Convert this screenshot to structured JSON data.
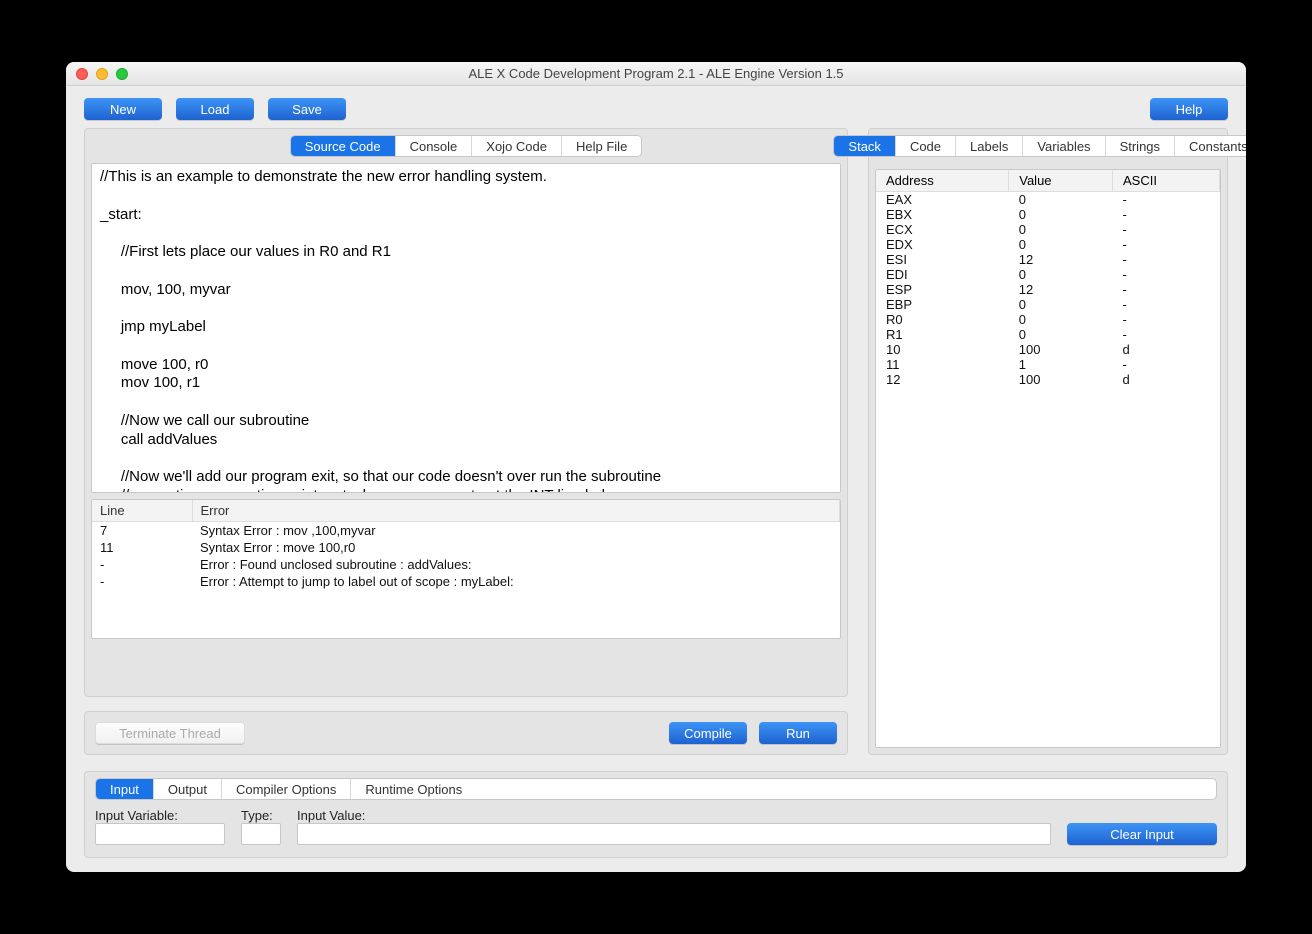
{
  "window_title": "ALE X Code Development Program 2.1 - ALE Engine Version 1.5",
  "toolbar": {
    "new": "New",
    "load": "Load",
    "save": "Save",
    "help": "Help"
  },
  "left_tabs": [
    "Source Code",
    "Console",
    "Xojo Code",
    "Help File"
  ],
  "left_tab_active": 0,
  "source_code": "//This is an example to demonstrate the new error handling system.\n\n_start:\n\n     //First lets place our values in R0 and R1\n\n     mov, 100, myvar\n\n     jmp myLabel\n\n     move 100, r0\n     mov 100, r1\n\n     //Now we call our subroutine\n     call addValues\n\n     //Now we'll add our program exit, so that our code doesn't over run the subroutine\n     //generating a execution pointer stack error, comment out the INT line below\n     //if you wish to see that.",
  "error_headers": [
    "Line",
    "Error"
  ],
  "errors": [
    {
      "line": "7",
      "msg": "Syntax Error : mov ,100,myvar"
    },
    {
      "line": "11",
      "msg": "Syntax Error : move 100,r0"
    },
    {
      "line": "-",
      "msg": "Error : Found unclosed subroutine : addValues:"
    },
    {
      "line": "-",
      "msg": "Error : Attempt to jump to label out of scope : myLabel:"
    }
  ],
  "actions": {
    "terminate": "Terminate Thread",
    "compile": "Compile",
    "run": "Run"
  },
  "right_tabs": [
    "Stack",
    "Code",
    "Labels",
    "Variables",
    "Strings",
    "Constants"
  ],
  "right_tab_active": 0,
  "stack_headers": [
    "Address",
    "Value",
    "ASCII"
  ],
  "stack": [
    {
      "a": "EAX",
      "v": "0",
      "c": "-"
    },
    {
      "a": "EBX",
      "v": "0",
      "c": "-"
    },
    {
      "a": "ECX",
      "v": "0",
      "c": "-"
    },
    {
      "a": "EDX",
      "v": "0",
      "c": "-"
    },
    {
      "a": "ESI",
      "v": "12",
      "c": "-"
    },
    {
      "a": "EDI",
      "v": "0",
      "c": "-"
    },
    {
      "a": "ESP",
      "v": "12",
      "c": "-"
    },
    {
      "a": "EBP",
      "v": "0",
      "c": "-"
    },
    {
      "a": "R0",
      "v": "0",
      "c": "-"
    },
    {
      "a": "R1",
      "v": "0",
      "c": "-"
    },
    {
      "a": "10",
      "v": "100",
      "c": "d"
    },
    {
      "a": "11",
      "v": "1",
      "c": "-"
    },
    {
      "a": "12",
      "v": "100",
      "c": "d"
    }
  ],
  "bottom_tabs": [
    "Input",
    "Output",
    "Compiler Options",
    "Runtime Options"
  ],
  "bottom_tab_active": 0,
  "input_labels": {
    "variable": "Input Variable:",
    "type": "Type:",
    "value": "Input Value:",
    "clear": "Clear Input"
  }
}
